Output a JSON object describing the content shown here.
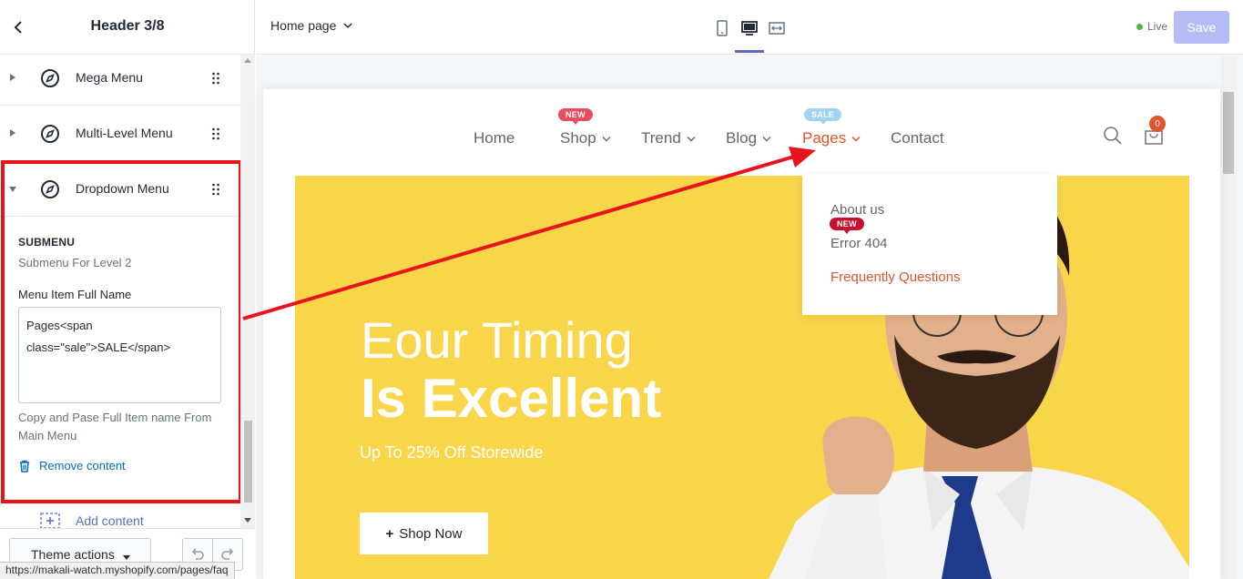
{
  "sidebar": {
    "title": "Header 3/8",
    "menu_items": [
      {
        "label": "Mega Menu"
      },
      {
        "label": "Multi-Level Menu"
      },
      {
        "label": "Dropdown Menu"
      }
    ],
    "panel": {
      "section_title": "SUBMENU",
      "section_subtitle": "Submenu For Level 2",
      "field_label": "Menu Item Full Name",
      "field_value": "Pages<span class=\"sale\">SALE</span>",
      "help_text": "Copy and Pase Full Item name From Main Menu",
      "remove_label": "Remove content"
    },
    "add_content_label": "Add content",
    "footer": {
      "theme_actions_label": "Theme actions"
    },
    "status_url": "https://makali-watch.myshopify.com/pages/faq"
  },
  "topbar": {
    "page_select": "Home page",
    "live_label": "Live",
    "save_label": "Save",
    "live_color": "#50b83c",
    "accent_color": "#5c6ac4"
  },
  "preview": {
    "nav": [
      {
        "label": "Home"
      },
      {
        "label": "Shop"
      },
      {
        "label": "Trend"
      },
      {
        "label": "Blog"
      },
      {
        "label": "Pages"
      },
      {
        "label": "Contact"
      }
    ],
    "badges": {
      "shop": "NEW",
      "pages": "SALE",
      "error": "NEW"
    },
    "cart_count": "0",
    "dropdown": [
      {
        "label": "About us"
      },
      {
        "label": "Error 404"
      },
      {
        "label": "Frequently Questions"
      }
    ],
    "hero": {
      "title_line1": "Eour Timing",
      "title_line2": "Is Excellent",
      "subtitle": "Up To 25% Off Storewide",
      "cta": "Shop Now"
    },
    "brand_color": "#e2532a",
    "hero_color": "#f9d549"
  },
  "icons": [
    "back-arrow-icon",
    "compass-icon",
    "drag-handle-icon",
    "trash-icon",
    "add-section-icon",
    "undo-icon",
    "redo-icon",
    "chevron-down-icon",
    "mobile-icon",
    "desktop-icon",
    "fullscreen-icon",
    "search-icon",
    "cart-icon"
  ]
}
